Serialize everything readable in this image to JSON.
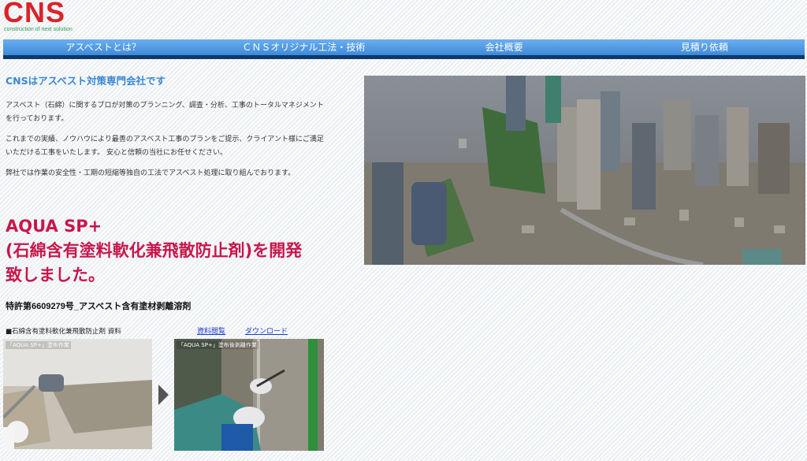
{
  "header": {
    "logo": "CNS",
    "tagline": "construction of next solution"
  },
  "nav": {
    "items": [
      {
        "label": "アスベストとは？"
      },
      {
        "label": "ＣＮＳオリジナル工法・技術"
      },
      {
        "label": "会社概要"
      },
      {
        "label": "見積り依頼"
      }
    ]
  },
  "intro": {
    "title": "CNSはアスベスト対策専門会社です",
    "paragraphs": [
      "アスベスト（石綿）に関するプロが対策のプランニング、調査・分析、工事のトータルマネジメントを行っております。",
      "これまでの実績、ノウハウにより最善のアスベスト工事のプランをご提示、クライアント様にご満足いただける工事をいたします。 安心と信頼の当社にお任せください。",
      "弊社では作業の安全性・工期の短縮等独自の工法でアスベスト処理に取り組んでおります。"
    ]
  },
  "product": {
    "line1": "AQUA SP+",
    "line2": "(石綿含有塗料軟化兼飛散防止剤)を開発",
    "line3": "致しました。"
  },
  "patent": "特許第6609279号_アスベスト含有塗材剥離溶剤",
  "materials": {
    "label": "■石綿含有塗料軟化兼飛散防止剤 資料",
    "link_request": "資料閲覧",
    "link_download": "ダウンロード"
  },
  "photos": {
    "caption_left": "「AQUA SP+」塗布作業",
    "caption_right": "「AQUA SP+」塗布後剥離作業"
  },
  "colors": {
    "brand_red": "#d9232a",
    "nav_blue": "#3f8ad8",
    "nav_dark": "#0e3a6b",
    "headline_pink": "#c8174b",
    "intro_blue": "#3a87d6"
  }
}
